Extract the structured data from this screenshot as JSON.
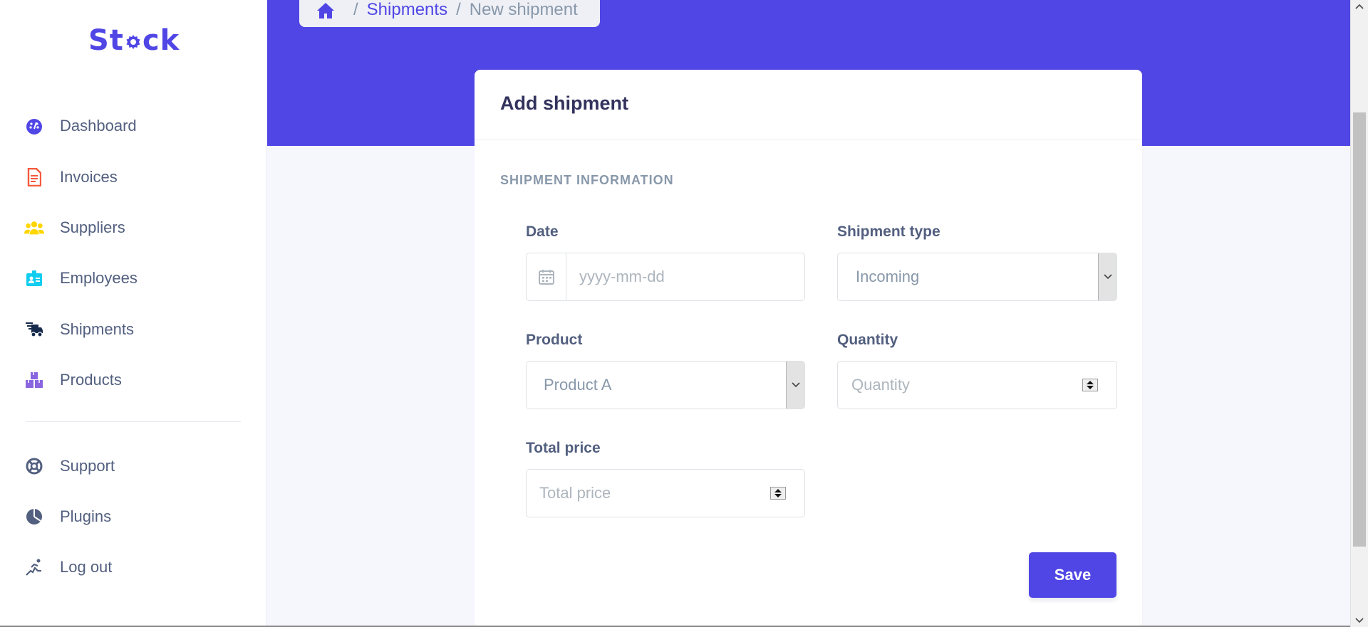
{
  "app": {
    "logo_text_before": "St",
    "logo_text_after": "ck"
  },
  "sidebar": {
    "items": [
      {
        "label": "Dashboard",
        "icon": "dashboard-gauge-icon",
        "color": "#5046e5"
      },
      {
        "label": "Invoices",
        "icon": "invoice-file-icon",
        "color": "#f5593d"
      },
      {
        "label": "Suppliers",
        "icon": "users-group-icon",
        "color": "#ffd600"
      },
      {
        "label": "Employees",
        "icon": "id-badge-icon",
        "color": "#11cdef"
      },
      {
        "label": "Shipments",
        "icon": "truck-fast-icon",
        "color": "#172b4d"
      },
      {
        "label": "Products",
        "icon": "boxes-icon",
        "color": "#8965e0"
      }
    ],
    "secondary": [
      {
        "label": "Support",
        "icon": "life-ring-icon"
      },
      {
        "label": "Plugins",
        "icon": "pie-chart-icon"
      },
      {
        "label": "Log out",
        "icon": "running-logout-icon"
      }
    ]
  },
  "breadcrumb": {
    "link": "Shipments",
    "current": "New shipment"
  },
  "form": {
    "title": "Add shipment",
    "section": "SHIPMENT INFORMATION",
    "date": {
      "label": "Date",
      "placeholder": "yyyy-mm-dd"
    },
    "shipment_type": {
      "label": "Shipment type",
      "value": "Incoming"
    },
    "product": {
      "label": "Product",
      "value": "Product A"
    },
    "quantity": {
      "label": "Quantity",
      "placeholder": "Quantity"
    },
    "total_price": {
      "label": "Total price",
      "placeholder": "Total price"
    },
    "save_label": "Save"
  },
  "colors": {
    "primary": "#5046e5",
    "background": "#f6f7fc"
  }
}
